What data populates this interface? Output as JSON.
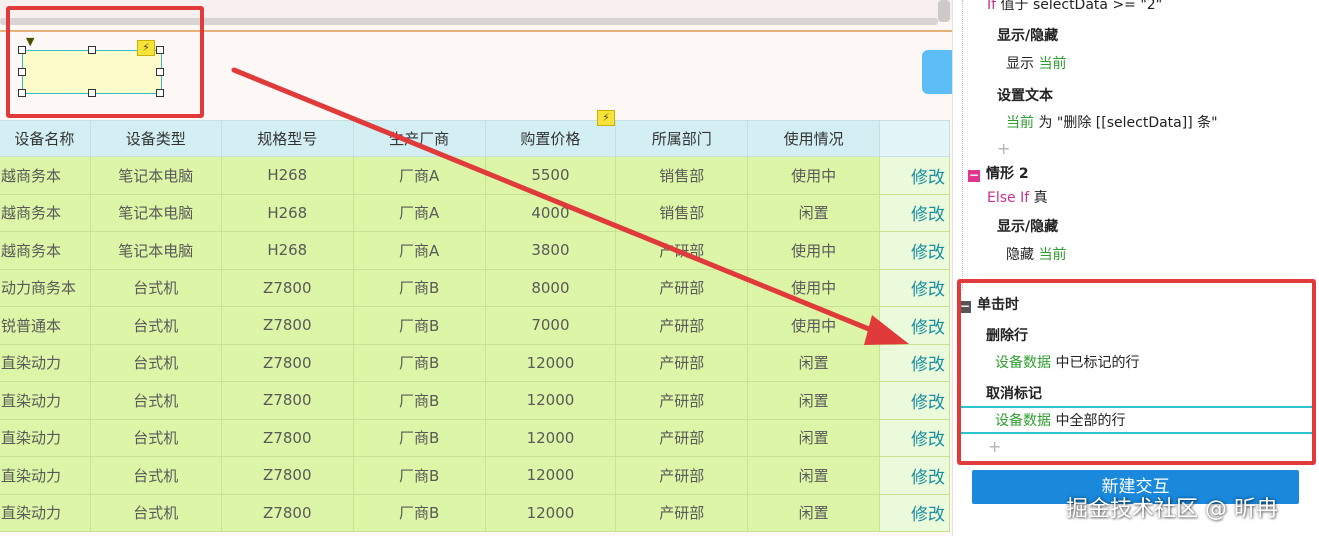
{
  "canvas": {
    "table": {
      "headers": [
        "设备名称",
        "设备类型",
        "规格型号",
        "生产厂商",
        "购置价格",
        "所属部门",
        "使用情况"
      ],
      "edit_label": "修改",
      "rows": [
        [
          "越商务本",
          "笔记本电脑",
          "H268",
          "厂商A",
          "5500",
          "销售部",
          "使用中"
        ],
        [
          "越商务本",
          "笔记本电脑",
          "H268",
          "厂商A",
          "4000",
          "销售部",
          "闲置"
        ],
        [
          "越商务本",
          "笔记本电脑",
          "H268",
          "厂商A",
          "3800",
          "产研部",
          "使用中"
        ],
        [
          "动力商务本",
          "台式机",
          "Z7800",
          "厂商B",
          "8000",
          "产研部",
          "使用中"
        ],
        [
          "锐普通本",
          "台式机",
          "Z7800",
          "厂商B",
          "7000",
          "产研部",
          "使用中"
        ],
        [
          "直染动力",
          "台式机",
          "Z7800",
          "厂商B",
          "12000",
          "产研部",
          "闲置"
        ],
        [
          "直染动力",
          "台式机",
          "Z7800",
          "厂商B",
          "12000",
          "产研部",
          "闲置"
        ],
        [
          "直染动力",
          "台式机",
          "Z7800",
          "厂商B",
          "12000",
          "产研部",
          "闲置"
        ],
        [
          "直染动力",
          "台式机",
          "Z7800",
          "厂商B",
          "12000",
          "产研部",
          "闲置"
        ],
        [
          "直染动力",
          "台式机",
          "Z7800",
          "厂商B",
          "12000",
          "产研部",
          "闲置"
        ]
      ]
    }
  },
  "panel": {
    "line1_kw": "If",
    "line1_text": "值于 selectData >= \"2\"",
    "show_hide_1": "显示/隐藏",
    "show_action": "显示",
    "current_1": "当前",
    "set_text": "设置文本",
    "current_2": "当前",
    "set_text_value": "为 \"删除 [[selectData]] 条\"",
    "plus": "+",
    "case2_label": "情形 2",
    "case2_kw": "Else If",
    "case2_cond": "真",
    "show_hide_2": "显示/隐藏",
    "hide_action": "隐藏",
    "current_3": "当前",
    "on_click": "单击时",
    "delete_rows": "删除行",
    "dataset_1": "设备数据",
    "marked_rows": "中已标记的行",
    "unmark": "取消标记",
    "dataset_2": "设备数据",
    "all_rows": "中全部的行",
    "new_interaction": "新建交互",
    "pbox_minus": "−"
  },
  "watermark": "掘金技术社区 @ 昕冉",
  "colors": {
    "annotation_red": "#e03a3a",
    "header_bg": "#d3eff3",
    "row_bg": "#dcf5a6",
    "new_button": "#1a88db",
    "keyword": "#c4338f",
    "value_green": "#2f9e2f"
  }
}
